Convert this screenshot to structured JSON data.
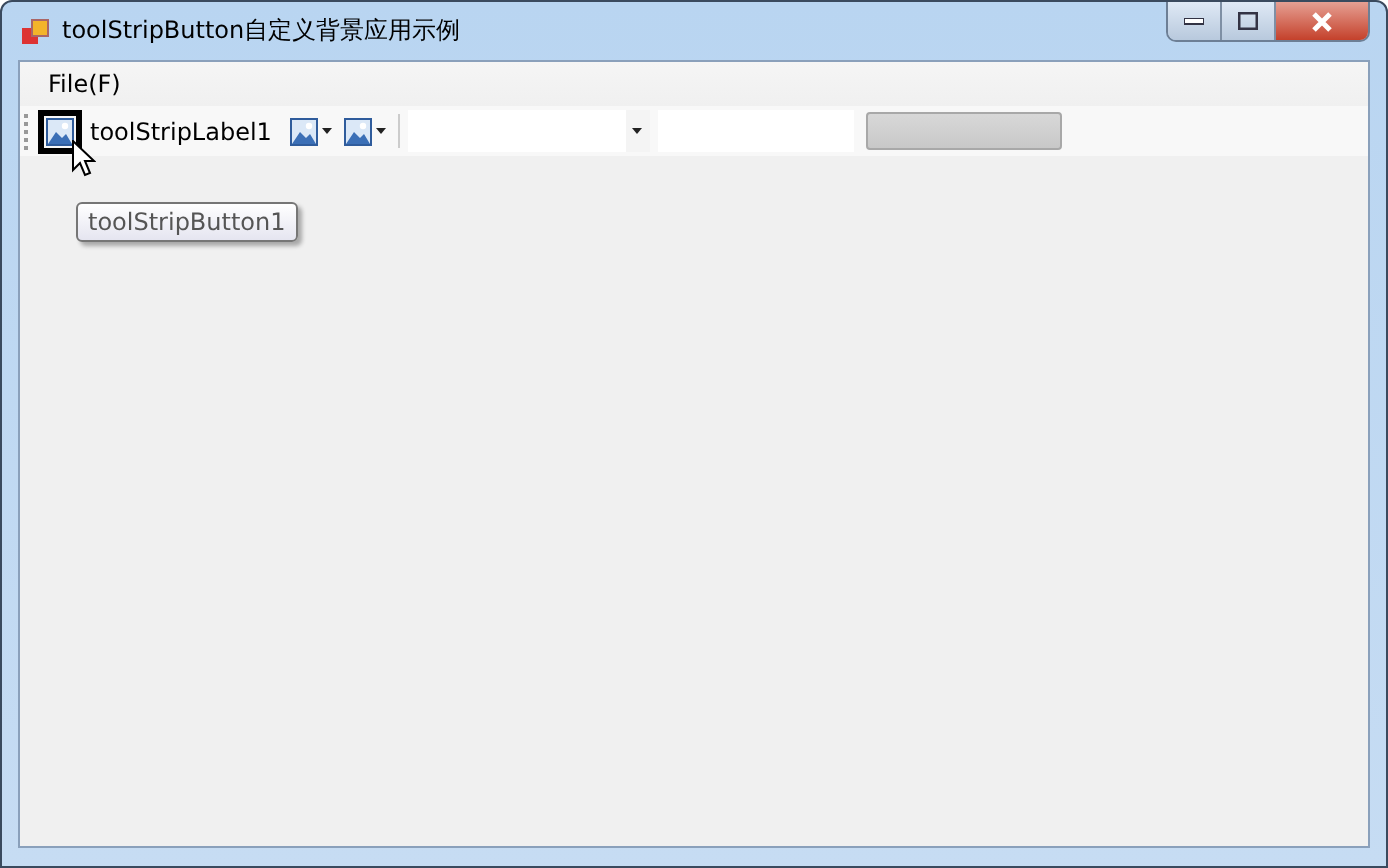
{
  "window": {
    "title": "toolStripButton自定义背景应用示例"
  },
  "menu": [
    {
      "label": "File(F)"
    }
  ],
  "toolbar": [
    {
      "kind": "button",
      "hovered": true
    },
    {
      "kind": "label",
      "label": "toolStripLabel1"
    },
    {
      "kind": "split"
    },
    {
      "kind": "dropdown"
    },
    {
      "kind": "separator"
    },
    {
      "kind": "combo"
    },
    {
      "kind": "textbox"
    },
    {
      "kind": "progress",
      "level": 0
    }
  ],
  "tooltip": {
    "text": "toolStripButton1"
  }
}
